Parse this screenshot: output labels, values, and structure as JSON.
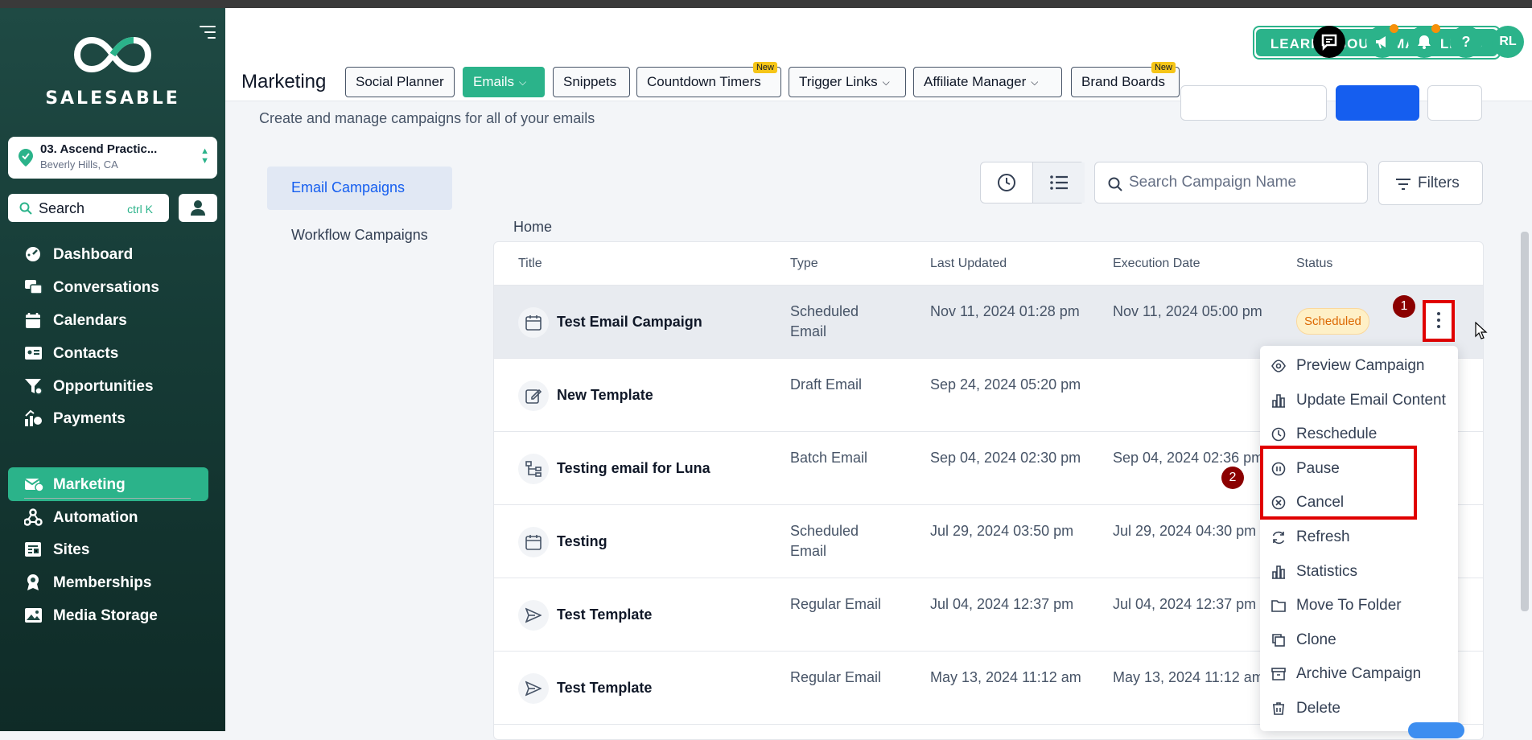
{
  "brand": {
    "name": "SALESABLE"
  },
  "account": {
    "name": "03. Ascend Practic...",
    "location": "Beverly Hills, CA"
  },
  "search": {
    "label": "Search",
    "shortcut": "ctrl K"
  },
  "nav": [
    {
      "label": "Dashboard",
      "icon": "dashboard-icon"
    },
    {
      "label": "Conversations",
      "icon": "conversations-icon"
    },
    {
      "label": "Calendars",
      "icon": "calendar-icon"
    },
    {
      "label": "Contacts",
      "icon": "contacts-icon"
    },
    {
      "label": "Opportunities",
      "icon": "opportunities-icon"
    },
    {
      "label": "Payments",
      "icon": "payments-icon"
    },
    {
      "label": "Marketing",
      "icon": "marketing-icon",
      "active": true
    },
    {
      "label": "Automation",
      "icon": "automation-icon"
    },
    {
      "label": "Sites",
      "icon": "sites-icon"
    },
    {
      "label": "Memberships",
      "icon": "memberships-icon"
    },
    {
      "label": "Media Storage",
      "icon": "media-icon"
    }
  ],
  "topbar": {
    "learn": "LEARN ABOUT SMART LISTS",
    "avatar": "RL",
    "help": "?"
  },
  "tabs": {
    "title": "Marketing",
    "items": [
      {
        "label": "Social Planner"
      },
      {
        "label": "Emails",
        "active": true,
        "dropdown": true
      },
      {
        "label": "Snippets"
      },
      {
        "label": "Countdown Timers",
        "badge": "New"
      },
      {
        "label": "Trigger Links",
        "dropdown": true
      },
      {
        "label": "Affiliate Manager",
        "dropdown": true
      },
      {
        "label": "Brand Boards",
        "badge": "New"
      }
    ]
  },
  "page": {
    "subtitle": "Create and manage campaigns for all of your emails"
  },
  "sidetabs": [
    "Email Campaigns",
    "Workflow Campaigns"
  ],
  "campaign_search": {
    "placeholder": "Search Campaign Name"
  },
  "filters": "Filters",
  "breadcrumb": "Home",
  "table": {
    "headers": [
      "Title",
      "Type",
      "Last Updated",
      "Execution Date",
      "Status"
    ],
    "rows": [
      {
        "title": "Test Email Campaign",
        "icon": "calendar-icon",
        "type": "Scheduled Email",
        "updated": "Nov 11, 2024 01:28 pm",
        "execution": "Nov 11, 2024 05:00 pm",
        "status": "Scheduled"
      },
      {
        "title": "New Template",
        "icon": "edit-icon",
        "type": "Draft Email",
        "updated": "Sep 24, 2024 05:20 pm",
        "execution": "",
        "status": ""
      },
      {
        "title": "Testing email for Luna",
        "icon": "branch-icon",
        "type": "Batch Email",
        "updated": "Sep 04, 2024 02:30 pm",
        "execution": "Sep 04, 2024 02:36 pm",
        "status": ""
      },
      {
        "title": "Testing",
        "icon": "calendar-icon",
        "type": "Scheduled Email",
        "updated": "Jul 29, 2024 03:50 pm",
        "execution": "Jul 29, 2024 04:30 pm",
        "status": ""
      },
      {
        "title": "Test Template",
        "icon": "send-icon",
        "type": "Regular Email",
        "updated": "Jul 04, 2024 12:37 pm",
        "execution": "Jul 04, 2024 12:37 pm",
        "status": ""
      },
      {
        "title": "Test Template",
        "icon": "send-icon",
        "type": "Regular Email",
        "updated": "May 13, 2024 11:12 am",
        "execution": "May 13, 2024 11:12 am",
        "status": ""
      }
    ]
  },
  "menu": [
    {
      "label": "Preview Campaign",
      "icon": "eye-icon"
    },
    {
      "label": "Update Email Content",
      "icon": "chart-icon"
    },
    {
      "label": "Reschedule",
      "icon": "clock-icon"
    },
    {
      "label": "Pause",
      "icon": "pause-icon"
    },
    {
      "label": "Cancel",
      "icon": "cancel-icon"
    },
    {
      "label": "Refresh",
      "icon": "refresh-icon"
    },
    {
      "label": "Statistics",
      "icon": "chart-icon"
    },
    {
      "label": "Move To Folder",
      "icon": "folder-icon"
    },
    {
      "label": "Clone",
      "icon": "clone-icon"
    },
    {
      "label": "Archive Campaign",
      "icon": "archive-icon"
    },
    {
      "label": "Delete",
      "icon": "trash-icon"
    }
  ],
  "markers": [
    "1",
    "2"
  ],
  "colors": {
    "brand": "#2bb38a",
    "highlight": "#e00000",
    "scheduled": "#dc6803"
  }
}
